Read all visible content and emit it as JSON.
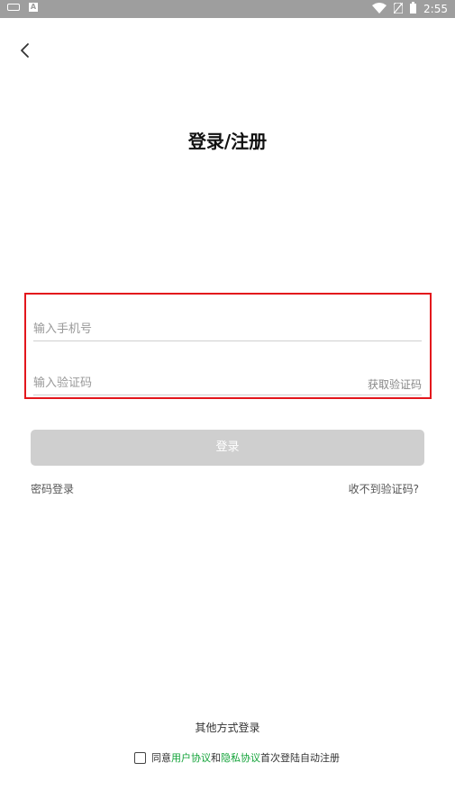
{
  "status_bar": {
    "time": "2:55",
    "icons": [
      "keyboard-icon",
      "ime-icon",
      "wifi-icon",
      "no-sim-icon",
      "battery-icon"
    ]
  },
  "nav": {
    "back_icon": "chevron-left-icon"
  },
  "page": {
    "title": "登录/注册"
  },
  "form": {
    "phone_placeholder": "输入手机号",
    "code_placeholder": "输入验证码",
    "get_code_label": "获取验证码",
    "login_label": "登录"
  },
  "links": {
    "password_login": "密码登录",
    "no_code": "收不到验证码?"
  },
  "footer": {
    "other_login": "其他方式登录",
    "agree_prefix": "同意",
    "user_agreement": "用户协议",
    "and": "和",
    "privacy_agreement": "隐私协议",
    "agree_suffix": "首次登陆自动注册"
  },
  "colors": {
    "accent_green": "#13a339",
    "highlight_red": "#e3161c",
    "button_disabled": "#cfcfcf"
  }
}
